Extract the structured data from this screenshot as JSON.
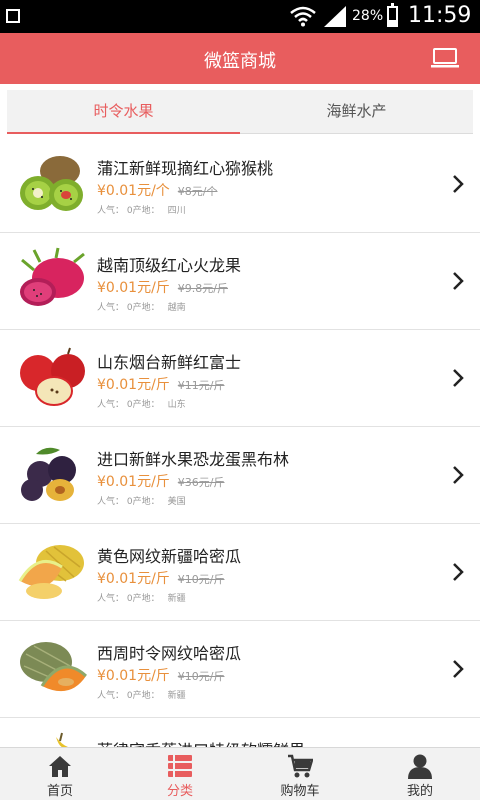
{
  "status_bar": {
    "battery": "28%",
    "time": "11:59"
  },
  "header": {
    "title": "微篮商城",
    "right_icon": "laptop-icon"
  },
  "tabs": [
    {
      "label": "时令水果",
      "active": true
    },
    {
      "label": "海鲜水产",
      "active": false
    }
  ],
  "products": [
    {
      "name": "蒲江新鲜现摘红心猕猴桃",
      "price": "¥0.01元/个",
      "old_price": "¥8元/个",
      "popularity": "人气： 0",
      "origin_label": "产地：",
      "origin": "四川",
      "image": "kiwi"
    },
    {
      "name": "越南顶级红心火龙果",
      "price": "¥0.01元/斤",
      "old_price": "¥9.8元/斤",
      "popularity": "人气： 0",
      "origin_label": "产地：",
      "origin": "越南",
      "image": "dragonfruit"
    },
    {
      "name": "山东烟台新鲜红富士",
      "price": "¥0.01元/斤",
      "old_price": "¥11元/斤",
      "popularity": "人气： 0",
      "origin_label": "产地：",
      "origin": "山东",
      "image": "apple"
    },
    {
      "name": "进口新鲜水果恐龙蛋黑布林",
      "price": "¥0.01元/斤",
      "old_price": "¥36元/斤",
      "popularity": "人气： 0",
      "origin_label": "产地：",
      "origin": "美国",
      "image": "plum"
    },
    {
      "name": "黄色网纹新疆哈密瓜",
      "price": "¥0.01元/斤",
      "old_price": "¥10元/斤",
      "popularity": "人气： 0",
      "origin_label": "产地：",
      "origin": "新疆",
      "image": "melon-yellow"
    },
    {
      "name": "西周时令网纹哈密瓜",
      "price": "¥0.01元/斤",
      "old_price": "¥10元/斤",
      "popularity": "人气： 0",
      "origin_label": "产地：",
      "origin": "新疆",
      "image": "melon-green"
    },
    {
      "name": "菲律宾香蕉进口特级软糯鲜果",
      "price": "",
      "old_price": "",
      "popularity": "",
      "origin_label": "",
      "origin": "",
      "image": "banana"
    }
  ],
  "bottom_nav": [
    {
      "label": "首页",
      "icon": "home-icon",
      "active": false
    },
    {
      "label": "分类",
      "icon": "list-icon",
      "active": true
    },
    {
      "label": "购物车",
      "icon": "cart-icon",
      "active": false
    },
    {
      "label": "我的",
      "icon": "user-icon",
      "active": false
    }
  ],
  "colors": {
    "brand": "#e85d5e",
    "price": "#e8903c",
    "muted": "#999999"
  }
}
